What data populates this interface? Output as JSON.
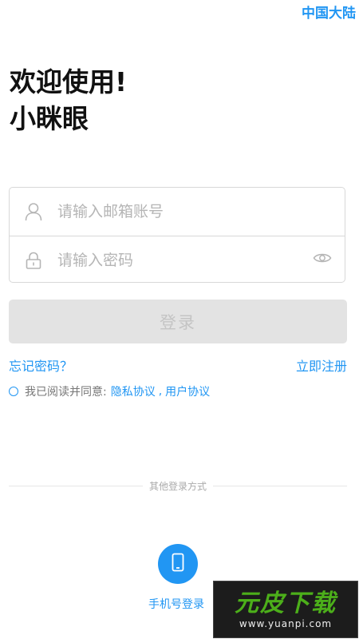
{
  "header": {
    "region": "中国大陆"
  },
  "welcome": {
    "line1": "欢迎使用!",
    "line2": "小眯眼"
  },
  "form": {
    "account_placeholder": "请输入邮箱账号",
    "password_placeholder": "请输入密码",
    "login_label": "登录",
    "account_icon": "user-icon",
    "password_icon": "lock-icon",
    "visibility_icon": "eye-icon"
  },
  "links": {
    "forgot": "忘记密码？",
    "register": "立即注册"
  },
  "agreement": {
    "prefix": "我已阅读并同意:",
    "privacy": "隐私协议",
    "separator": ",",
    "user": "用户协议"
  },
  "other_login": {
    "title": "其他登录方式",
    "phone_label": "手机号登录",
    "phone_icon": "mobile-phone-icon"
  },
  "watermark": {
    "name": "元皮下载",
    "url": "www.yuanpi.com"
  },
  "colors": {
    "accent": "#2196f3",
    "button_disabled": "#e3e3e3"
  }
}
